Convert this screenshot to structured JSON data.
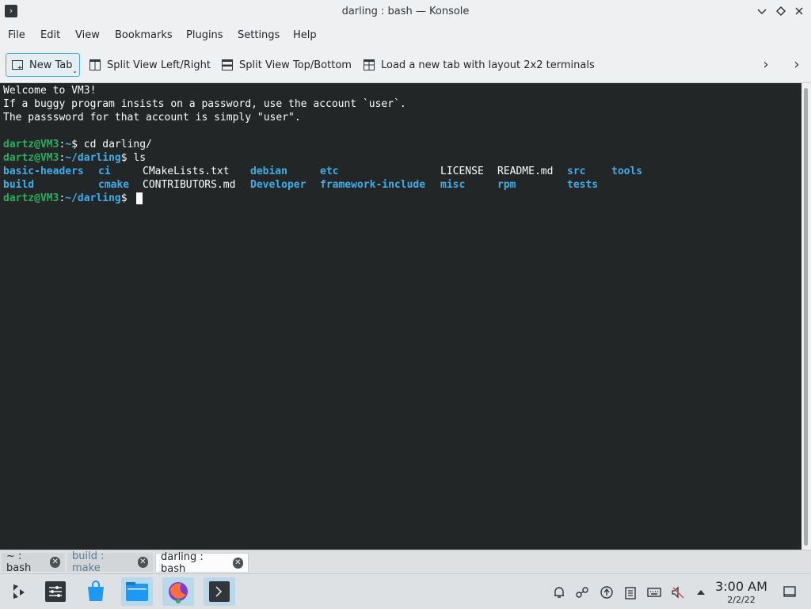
{
  "window": {
    "title": "darling : bash — Konsole"
  },
  "menu": [
    "File",
    "Edit",
    "View",
    "Bookmarks",
    "Plugins",
    "Settings",
    "Help"
  ],
  "toolbar": {
    "new_tab": "New Tab",
    "split_lr": "Split View Left/Right",
    "split_tb": "Split View Top/Bottom",
    "layout_2x2": "Load a new tab with layout 2x2 terminals"
  },
  "terminal": {
    "motd": [
      "Welcome to VM3!",
      "If a buggy program insists on a password, use the account `user`.",
      "The passsword for that account is simply \"user\"."
    ],
    "prompt1": {
      "userhost": "dartz@VM3",
      "sep": ":",
      "path": "~",
      "end": "$ ",
      "cmd": "cd darling/"
    },
    "prompt2": {
      "userhost": "dartz@VM3",
      "sep": ":",
      "path": "~/darling",
      "end": "$ ",
      "cmd": "ls"
    },
    "ls_row1": [
      {
        "name": "basic-headers",
        "type": "dir"
      },
      {
        "name": "ci",
        "type": "dir"
      },
      {
        "name": "CMakeLists.txt",
        "type": "file"
      },
      {
        "name": "debian",
        "type": "dir"
      },
      {
        "name": "etc",
        "type": "dir"
      },
      {
        "name": "LICENSE",
        "type": "file"
      },
      {
        "name": "README.md",
        "type": "file"
      },
      {
        "name": "src",
        "type": "dir"
      },
      {
        "name": "tools",
        "type": "dir"
      }
    ],
    "ls_row2": [
      {
        "name": "build",
        "type": "dir"
      },
      {
        "name": "cmake",
        "type": "dir"
      },
      {
        "name": "CONTRIBUTORS.md",
        "type": "file"
      },
      {
        "name": "Developer",
        "type": "dir"
      },
      {
        "name": "framework-include",
        "type": "dir"
      },
      {
        "name": "misc",
        "type": "dir"
      },
      {
        "name": "rpm",
        "type": "dir"
      },
      {
        "name": "tests",
        "type": "dir"
      }
    ],
    "prompt3": {
      "userhost": "dartz@VM3",
      "sep": ":",
      "path": "~/darling",
      "end": "$ "
    }
  },
  "tabs": [
    {
      "label": "~ : bash"
    },
    {
      "label": "build : make"
    },
    {
      "label": "darling : bash"
    }
  ],
  "taskbar": {
    "time": "3:00 AM",
    "date": "2/2/22"
  },
  "colors": {
    "terminal_bg": "#232627",
    "prompt_green": "#27ae60",
    "dir_blue": "#3daee9",
    "accent": "#3daee9"
  }
}
